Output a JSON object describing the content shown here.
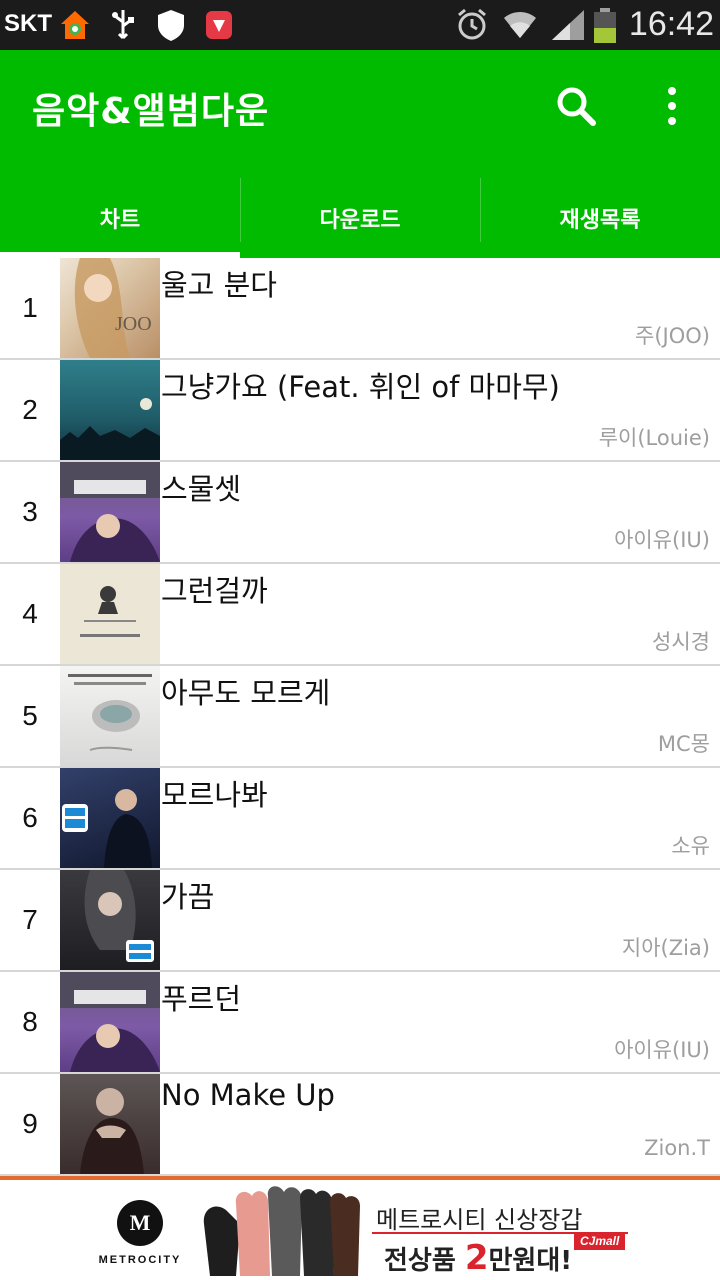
{
  "status_bar": {
    "carrier": "SKT",
    "time": "16:42"
  },
  "app": {
    "title": "음악&앨범다운",
    "accent_color": "#00bb00"
  },
  "tabs": [
    {
      "label": "차트",
      "active": true
    },
    {
      "label": "다운로드",
      "active": false
    },
    {
      "label": "재생목록",
      "active": false
    }
  ],
  "chart": [
    {
      "rank": "1",
      "song": "울고 분다",
      "artist": "주(JOO)"
    },
    {
      "rank": "2",
      "song": "그냥가요 (Feat. 휘인 of 마마무)",
      "artist": "루이(Louie)"
    },
    {
      "rank": "3",
      "song": "스물셋",
      "artist": "아이유(IU)"
    },
    {
      "rank": "4",
      "song": "그런걸까",
      "artist": "성시경"
    },
    {
      "rank": "5",
      "song": "아무도 모르게",
      "artist": "MC몽"
    },
    {
      "rank": "6",
      "song": "모르나봐",
      "artist": "소유"
    },
    {
      "rank": "7",
      "song": "가끔",
      "artist": "지아(Zia)"
    },
    {
      "rank": "8",
      "song": "푸르던",
      "artist": "아이유(IU)"
    },
    {
      "rank": "9",
      "song": "No Make Up",
      "artist": "Zion.T"
    }
  ],
  "ad": {
    "brand": "METROCITY",
    "logo_letter": "M",
    "line1": "메트로시티 신상장갑",
    "line2_prefix": "전상품 ",
    "line2_big": "2",
    "line2_suffix": "만원대!",
    "badge": "CJmall"
  }
}
